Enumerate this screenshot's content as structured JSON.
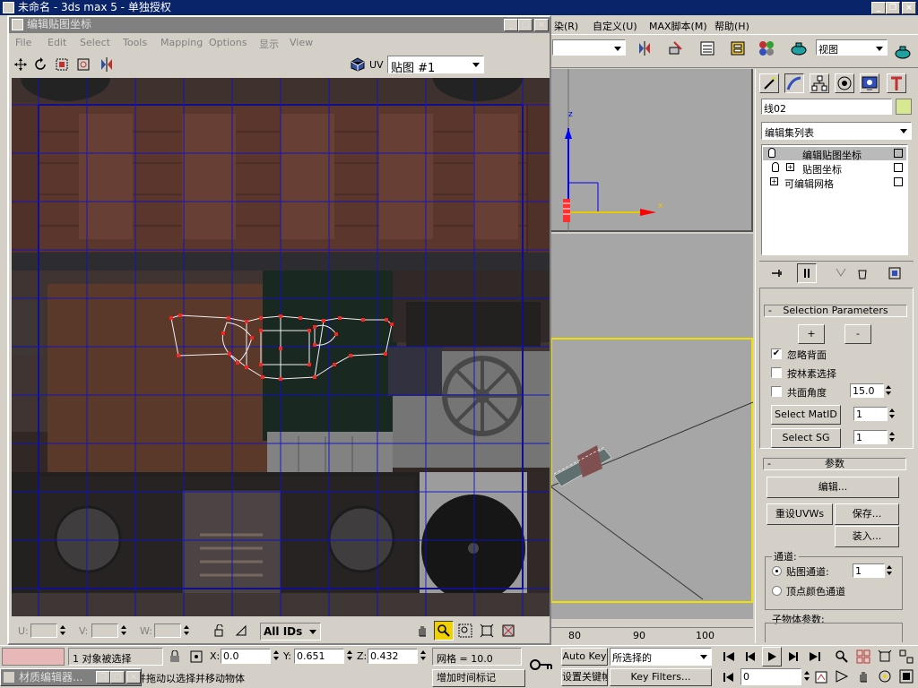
{
  "app": {
    "title": "未命名 - 3ds max 5 - 单独授权"
  },
  "main_menu": [
    "染(R)",
    "自定义(U)",
    "MAX脚本(M)",
    "帮助(H)"
  ],
  "main_toolbar": {
    "view_label": "视图"
  },
  "uv_editor": {
    "title": "编辑贴图坐标",
    "menu": [
      "File",
      "Edit",
      "Select",
      "Tools",
      "Mapping",
      "Options",
      "显示",
      "View"
    ],
    "uv_label": "UV",
    "map_select": "贴图 #1",
    "u_label": "U:",
    "v_label": "V:",
    "w_label": "W:",
    "ids_select": "All IDs"
  },
  "command_panel": {
    "object_name": "线02",
    "modifier_list": "编辑集列表",
    "stack": [
      "编辑贴图坐标",
      "贴图坐标",
      "可编辑网格"
    ],
    "selection_params": {
      "title": "Selection Parameters",
      "plus": "+",
      "minus": "-",
      "ignore_backfacing": "忽略背面",
      "by_element": "按林素选择",
      "planar_angle": "共面角度",
      "planar_value": "15.0",
      "select_matid": "Select MatID",
      "matid_value": "1",
      "select_sg": "Select SG",
      "sg_value": "1"
    },
    "params": {
      "title": "参数",
      "edit": "编辑...",
      "reset": "重设UVWs",
      "save": "保存...",
      "load": "装入...",
      "channel_label": "通道:",
      "map_channel": "贴图通道:",
      "map_channel_value": "1",
      "vertex_color": "顶点颜色通道",
      "subobj": "子物体参数:"
    }
  },
  "viewport": {
    "axis_x": "x",
    "axis_z": "z",
    "ruler": [
      "80",
      "90",
      "100"
    ]
  },
  "status": {
    "selected": "1 对象被选择",
    "x_label": "X:",
    "x_value": "0.0",
    "y_label": "Y:",
    "y_value": "0.651",
    "z_label": "Z:",
    "z_value": "0.432",
    "grid": "网格 = 10.0",
    "prompt": "单击并拖动以选择并移动物体",
    "add_time_tag": "增加时间标记",
    "auto_key": "Auto Key",
    "selected_combo": "所选择的",
    "set_key": "设置关键帧",
    "key_filters": "Key Filters...",
    "frame": "0"
  },
  "taskbar": {
    "mat_editor": "材质编辑器..."
  },
  "colors": {
    "title_active": "#0a246a",
    "title_inactive": "#808080",
    "uv_grid": "#0000c8",
    "selection": "#ff2020"
  }
}
